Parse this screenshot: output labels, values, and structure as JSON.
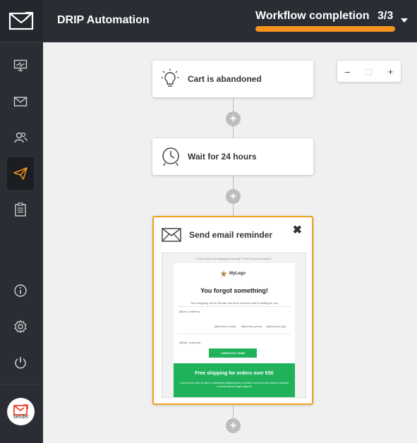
{
  "header": {
    "app_title": "DRIP Automation",
    "workflow_label": "Workflow completion",
    "workflow_count": "3/3",
    "workflow_progress": 1.0,
    "progress_color": "#f7941d"
  },
  "sidebar": {
    "items": [
      {
        "icon": "monitor-icon"
      },
      {
        "icon": "mail-icon"
      },
      {
        "icon": "users-icon"
      },
      {
        "icon": "paper-plane-icon",
        "active": true
      },
      {
        "icon": "clipboard-icon"
      },
      {
        "icon": "info-icon"
      },
      {
        "icon": "gear-icon"
      },
      {
        "icon": "power-icon"
      }
    ],
    "brand": "Sender"
  },
  "canvas": {
    "zoom": {
      "minus": "–",
      "fit": "⬚",
      "plus": "+"
    },
    "nodes": [
      {
        "icon": "lightbulb-icon",
        "label": "Cart is abandoned"
      },
      {
        "icon": "clock-icon",
        "label": "Wait for 24 hours"
      },
      {
        "icon": "envelope-icon",
        "label": "Send email reminder",
        "selected_color": "#f0a020"
      }
    ],
    "add_step": "+",
    "close": "✖"
  },
  "email_preview": {
    "top_note": "Is this email not displaying correctly? View it in your browser.",
    "logo": "MyLogo",
    "heading": "You forgot something!",
    "subtext": "Your shopping cart at Sender has been reserved and is waiting for you",
    "cart_contents_1": "{$cart_contents}",
    "product_name": "{$product_name}",
    "product_price": "{$product_price}",
    "product_qty": "x{$product_qty}",
    "cart_contents_2": "{/$cart_contents}",
    "button": "CHECKOUT NOW",
    "banner_title": "Free shipping for orders over €50",
    "banner_text": "Lorem ipsum dolor sit amet, consectetuer adipiscing elit, sed diam nonummy nibh euismod tincidunt ut laoreet dolore magna aliquam",
    "banner_color": "#1fb25a"
  }
}
